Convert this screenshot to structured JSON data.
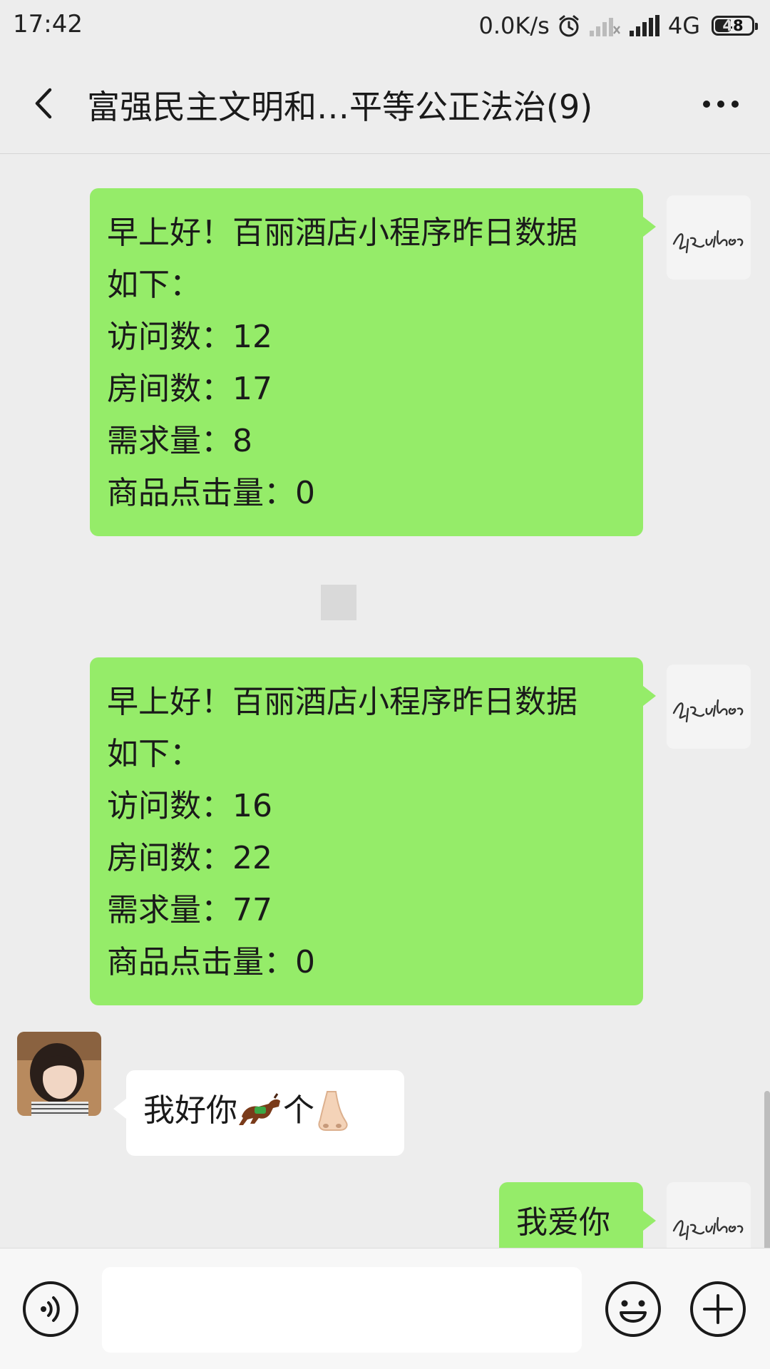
{
  "status_bar": {
    "time": "17:42",
    "net_speed": "0.0K/s",
    "net_type": "4G",
    "battery": "48",
    "battery_level": 0.48,
    "icons": [
      "alarm-icon",
      "signal-weak-icon",
      "signal-strong-icon"
    ]
  },
  "header": {
    "title": "富强民主文明和…平等公正法治(9)",
    "back_icon": "chevron-left-icon",
    "more_icon": "more-dots-icon"
  },
  "messages": [
    {
      "sender": "self",
      "lines": [
        "早上好！百丽酒店小程序昨日数据",
        "如下：",
        "访问数：12",
        "房间数：17",
        "需求量：8",
        "商品点击量：0"
      ]
    },
    {
      "sender": "self",
      "lines": [
        "早上好！百丽酒店小程序昨日数据",
        "如下：",
        "访问数：16",
        "房间数：22",
        "需求量：77",
        "商品点击量：0"
      ]
    },
    {
      "sender": "other",
      "text": "我好你",
      "text_after": "个",
      "emoji": [
        "horse-emoji",
        "nose-emoji"
      ]
    },
    {
      "sender": "self",
      "text": "我爱你"
    }
  ],
  "input_bar": {
    "value": "",
    "icons": [
      "voice-icon",
      "emoji-icon",
      "plus-icon"
    ]
  },
  "colors": {
    "background": "#ededed",
    "self_bubble": "#95ec69",
    "other_bubble": "#ffffff",
    "input_bar": "#f7f7f7"
  }
}
